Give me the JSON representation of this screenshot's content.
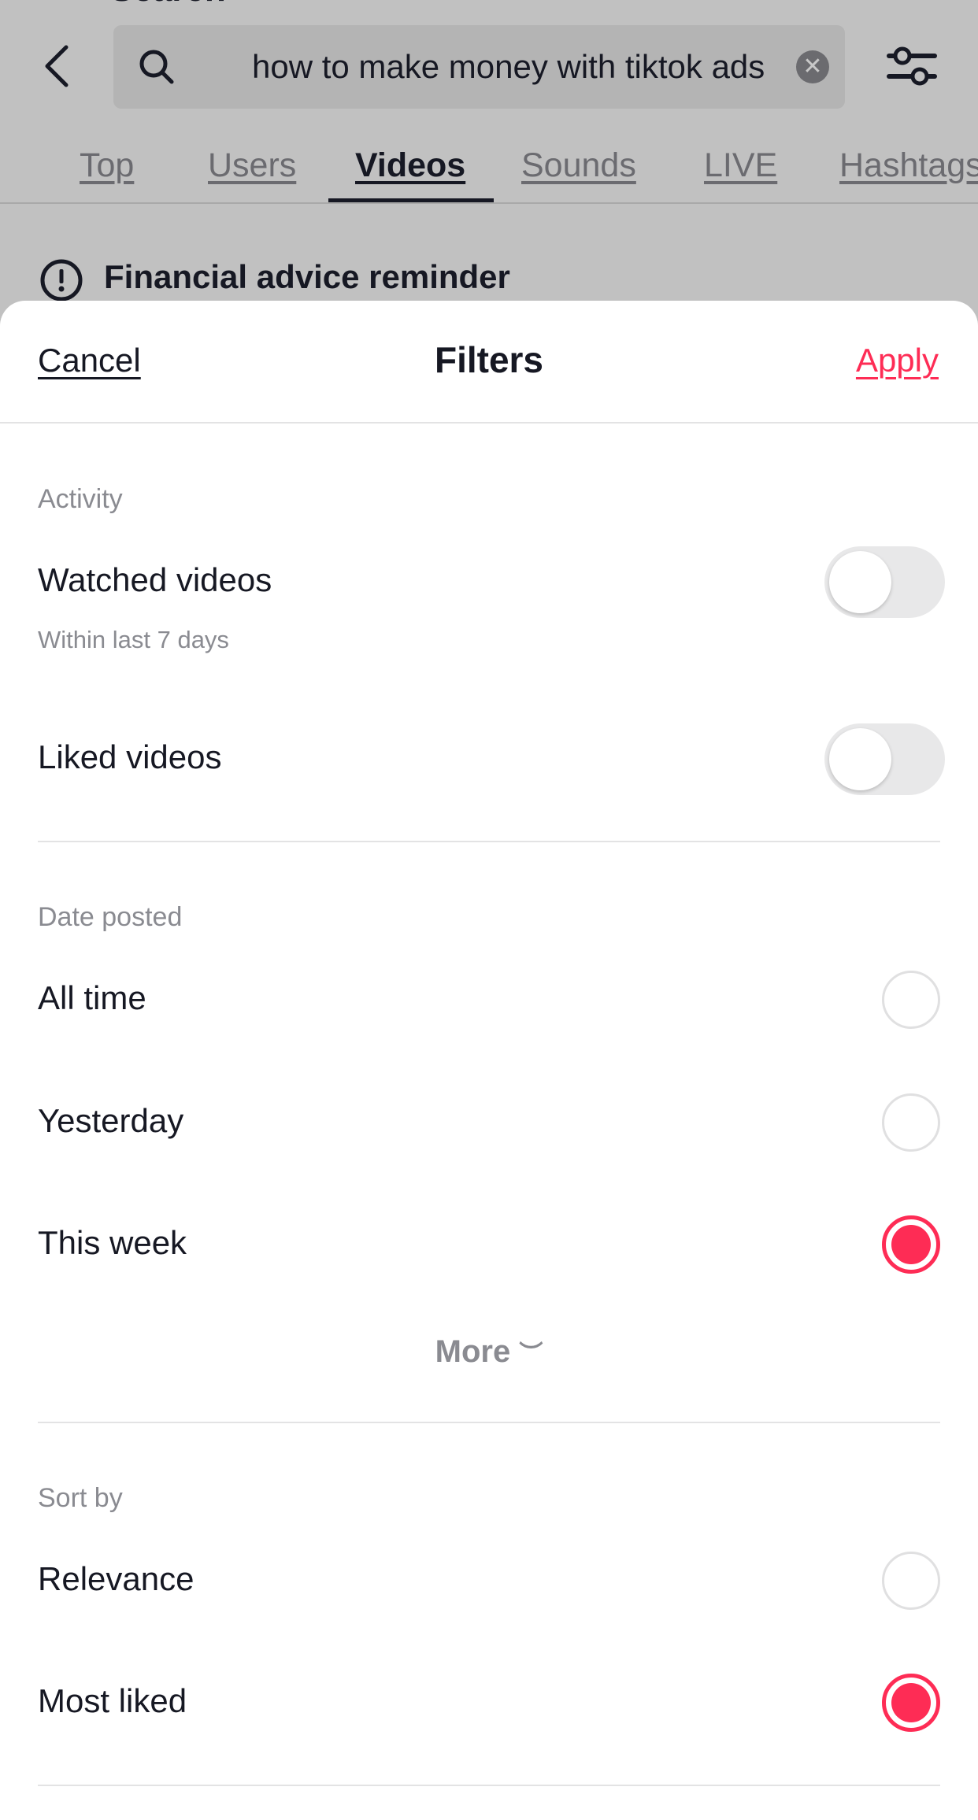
{
  "background": {
    "title": "Search",
    "search": {
      "value": "how to make money with tiktok ads"
    },
    "tabs": [
      {
        "label": "Top"
      },
      {
        "label": "Users"
      },
      {
        "label": "Videos",
        "active": true
      },
      {
        "label": "Sounds"
      },
      {
        "label": "LIVE"
      },
      {
        "label": "Hashtags"
      }
    ],
    "reminder": "Financial advice reminder"
  },
  "sheet": {
    "cancel": "Cancel",
    "title": "Filters",
    "apply": "Apply",
    "activity": {
      "label": "Activity",
      "watched": {
        "label": "Watched videos",
        "sub": "Within last 7 days",
        "on": false
      },
      "liked": {
        "label": "Liked videos",
        "on": false
      }
    },
    "date_posted": {
      "label": "Date posted",
      "options": [
        {
          "label": "All time",
          "selected": false
        },
        {
          "label": "Yesterday",
          "selected": false
        },
        {
          "label": "This week",
          "selected": true
        }
      ],
      "more": "More"
    },
    "sort_by": {
      "label": "Sort by",
      "options": [
        {
          "label": "Relevance",
          "selected": false
        },
        {
          "label": "Most liked",
          "selected": true
        }
      ]
    }
  },
  "colors": {
    "accent": "#fe2c55",
    "text": "#161823",
    "muted": "#8a8b91"
  }
}
